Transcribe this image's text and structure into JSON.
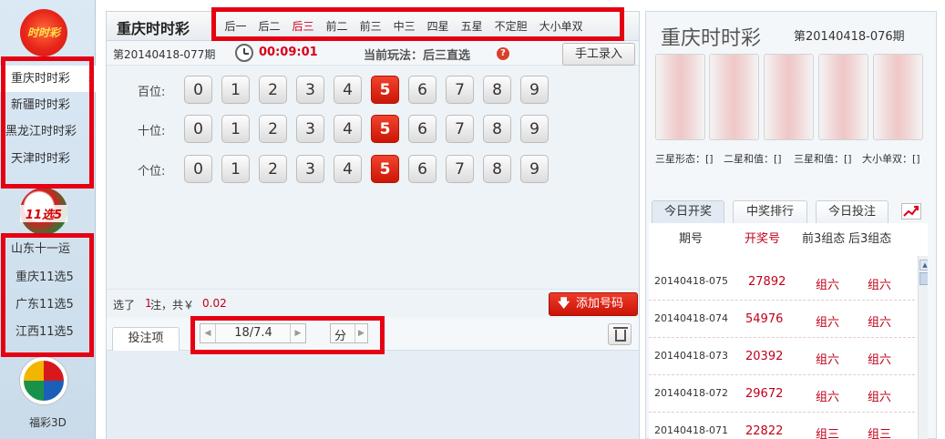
{
  "sidebar": {
    "logo_ssc_text": "时时彩",
    "group1": [
      "重庆时时彩",
      "新疆时时彩",
      "黑龙江时时彩",
      "天津时时彩"
    ],
    "selected_arrow": "›",
    "logo_11x5_text": "11选5",
    "group2": [
      "山东十一运",
      "重庆11选5",
      "广东11选5",
      "江西11选5"
    ],
    "fc3d_label": "福彩3D"
  },
  "main": {
    "title": "重庆时时彩",
    "tabs": [
      "后一",
      "后二",
      "后三",
      "前二",
      "前三",
      "中三",
      "四星",
      "五星",
      "不定胆",
      "大小单双"
    ],
    "active_tab": "后三",
    "period": "第20140418-077期",
    "countdown": "00:09:01",
    "play_label": "当前玩法：后三直选",
    "help_icon_text": "?",
    "manual_button": "手工录入",
    "rows": [
      {
        "label": "百位:",
        "selected": 5
      },
      {
        "label": "十位:",
        "selected": 5
      },
      {
        "label": "个位:",
        "selected": 5
      }
    ],
    "digits": [
      "0",
      "1",
      "2",
      "3",
      "4",
      "5",
      "6",
      "7",
      "8",
      "9"
    ],
    "summary": {
      "prefix": "选了",
      "count": "1",
      "mid": "注，共￥",
      "amount": "0.02"
    },
    "add_button": "添加号码",
    "bet_tab": "投注项",
    "multiplier_value": "18/7.4",
    "unit_value": "分"
  },
  "right": {
    "title": "重庆时时彩",
    "period": "第20140418-076期",
    "stats": [
      "三星形态：[]",
      "二星和值：[]",
      "三星和值：[]",
      "大小单双：[]"
    ],
    "tabs": [
      "今日开奖",
      "中奖排行",
      "今日投注"
    ],
    "table_headers": [
      "期号",
      "开奖号",
      "前3组态",
      "后3组态"
    ],
    "rows": [
      {
        "period": "20140418-075",
        "number": "27892",
        "front": "组六",
        "back": "组六"
      },
      {
        "period": "20140418-074",
        "number": "54976",
        "front": "组六",
        "back": "组六"
      },
      {
        "period": "20140418-073",
        "number": "20392",
        "front": "组六",
        "back": "组六"
      },
      {
        "period": "20140418-072",
        "number": "29672",
        "front": "组六",
        "back": "组六"
      },
      {
        "period": "20140418-071",
        "number": "22822",
        "front": "组三",
        "back": "组三"
      }
    ]
  },
  "colors": {
    "accent_red": "#e60012",
    "ball_red": "#d9261c",
    "text_red": "#c0001a"
  }
}
